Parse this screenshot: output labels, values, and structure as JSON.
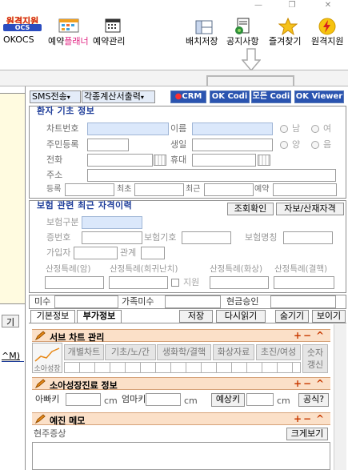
{
  "toolbar": {
    "okocs_logo_top": "원격지원",
    "okocs_logo_sub": "OCS",
    "okocs_label": "OKOCS",
    "reserve_planner": {
      "prefix": "예약",
      "highlight": "플래너"
    },
    "reserve_manage": "예약관리",
    "layout_save": "배치저장",
    "notice": "공지사항",
    "favorites": "즐겨찾기",
    "remote_support": "원격지원"
  },
  "window_controls": {
    "minimize": "—",
    "restore": "❐",
    "close": "✕"
  },
  "action_bar": {
    "sms": "SMS전송",
    "calc": "각종계산서출력",
    "crm": "CRM",
    "ok_codi": "OK Codi",
    "all_codi": "모든 Codi",
    "ok_viewer": "OK Viewer"
  },
  "patient": {
    "title": "환자 기초 정보",
    "chart_no": "차트번호",
    "name": "이름",
    "gender_male": "남",
    "gender_female": "여",
    "resident_no": "주민등록",
    "birth": "생일",
    "cal_solar": "양",
    "cal_lunar": "음",
    "phone": "전화",
    "mobile": "휴대",
    "address": "주소",
    "registered": "등록",
    "first": "최초",
    "recent": "최근",
    "reservation": "예약"
  },
  "insurance": {
    "title": "보험 관련 최근 자격이력",
    "lookup_button": "조회확인",
    "type_button": "자보/산재자격",
    "ins_type": "보험구분",
    "card_no": "증번호",
    "ins_symbol": "보험기호",
    "ins_name": "보험명칭",
    "subscriber": "가입자",
    "relation": "관계",
    "special_cancer": "산정특례(암)",
    "special_rare": "산정특례(희귀난치)",
    "special_burn": "산정특례(화상)",
    "special_tb": "산정특례(결핵)",
    "support": "지원"
  },
  "balance": {
    "unpaid": "미수",
    "family_unpaid": "가족미수",
    "cash_approval": "현금승인"
  },
  "tabs": {
    "basic": "기본정보",
    "extra": "부가정보",
    "save": "저장",
    "reload": "다시읽기",
    "hide": "숨기기",
    "show": "보이기"
  },
  "left_stub": {
    "label_a": "기",
    "label_b": "^M)"
  },
  "sub_chart": {
    "title": "서브 차트 관리",
    "growth_label": "소아성장",
    "columns": [
      "개별차트",
      "기초/노/간",
      "생화학/결핵",
      "화상자료",
      "초진/여성"
    ],
    "number_update": "숫자갱신"
  },
  "growth": {
    "title": "소아성장진료 정보",
    "father_height": "아빠키",
    "mother_height": "엄마키",
    "predicted_height": "예상키",
    "unit": "cm",
    "formula_button": "공식?"
  },
  "memo": {
    "title": "예진 메모",
    "current_symptom": "현주증상",
    "enlarge": "크게보기"
  },
  "controls": {
    "plus": "+",
    "minus": "−",
    "up": "^"
  },
  "colors": {
    "accent_blue": "#1f3e9a",
    "sub_header_bg": "#fbe0c8",
    "input_blue": "#dbe8fb"
  }
}
